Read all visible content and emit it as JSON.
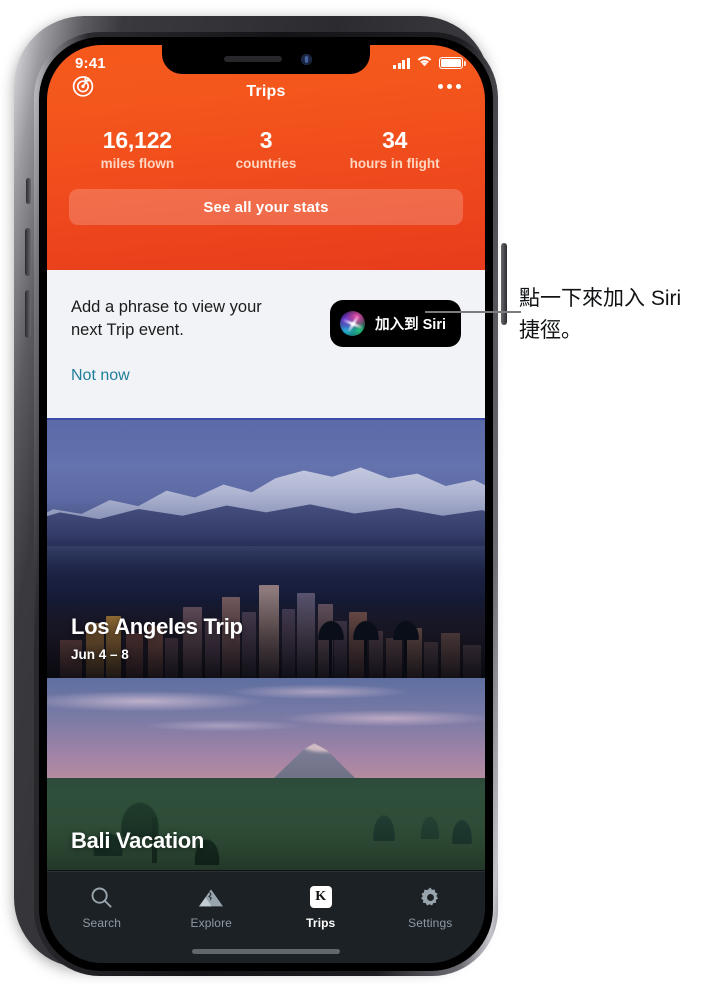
{
  "status_bar": {
    "time": "9:41",
    "cellular_icon": "signal-bars-icon",
    "wifi_icon": "wifi-icon",
    "battery_icon": "battery-icon"
  },
  "nav": {
    "title": "Trips",
    "left_icon": "radar-target-icon",
    "right_icon": "more-options-icon"
  },
  "stats": {
    "items": [
      {
        "value": "16,122",
        "label": "miles flown"
      },
      {
        "value": "3",
        "label": "countries"
      },
      {
        "value": "34",
        "label": "hours in flight"
      }
    ],
    "button_label": "See all your stats"
  },
  "siri_card": {
    "prompt": "Add a phrase to view your next Trip event.",
    "add_button_label": "加入到 Siri",
    "add_button_icon": "siri-orb-icon",
    "dismiss_label": "Not now"
  },
  "trips": [
    {
      "title": "Los Angeles Trip",
      "dates": "Jun 4 – 8",
      "image": "los-angeles-skyline-photo"
    },
    {
      "title": "Bali Vacation",
      "dates": "",
      "image": "bali-rice-terrace-photo"
    }
  ],
  "tab_bar": {
    "items": [
      {
        "label": "Search",
        "icon": "magnifier-icon",
        "active": false
      },
      {
        "label": "Explore",
        "icon": "mountains-icon",
        "active": false
      },
      {
        "label": "Trips",
        "icon": "k-badge-icon",
        "active": true
      },
      {
        "label": "Settings",
        "icon": "gear-icon",
        "active": false
      }
    ]
  },
  "callout": {
    "text": "點一下來加入 Siri 捷徑。"
  },
  "colors": {
    "header_top": "#f7591c",
    "header_bottom": "#e83c1c",
    "link": "#1f7f9b",
    "tabbar_bg": "#1c2126",
    "card_bg": "#f1f3f6"
  }
}
